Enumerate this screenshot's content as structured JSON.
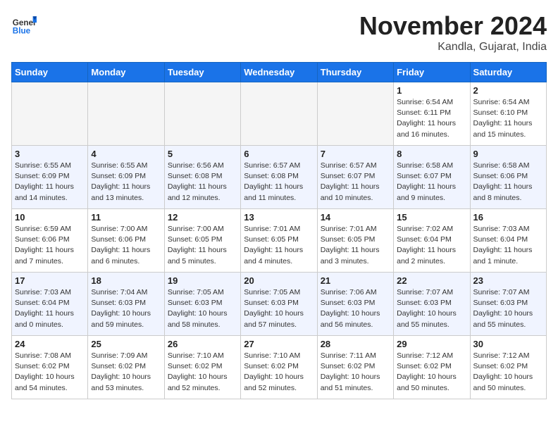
{
  "header": {
    "logo_general": "General",
    "logo_blue": "Blue",
    "month_title": "November 2024",
    "location": "Kandla, Gujarat, India"
  },
  "calendar": {
    "days_of_week": [
      "Sunday",
      "Monday",
      "Tuesday",
      "Wednesday",
      "Thursday",
      "Friday",
      "Saturday"
    ],
    "weeks": [
      [
        {
          "day": "",
          "info": ""
        },
        {
          "day": "",
          "info": ""
        },
        {
          "day": "",
          "info": ""
        },
        {
          "day": "",
          "info": ""
        },
        {
          "day": "",
          "info": ""
        },
        {
          "day": "1",
          "info": "Sunrise: 6:54 AM\nSunset: 6:11 PM\nDaylight: 11 hours\nand 16 minutes."
        },
        {
          "day": "2",
          "info": "Sunrise: 6:54 AM\nSunset: 6:10 PM\nDaylight: 11 hours\nand 15 minutes."
        }
      ],
      [
        {
          "day": "3",
          "info": "Sunrise: 6:55 AM\nSunset: 6:09 PM\nDaylight: 11 hours\nand 14 minutes."
        },
        {
          "day": "4",
          "info": "Sunrise: 6:55 AM\nSunset: 6:09 PM\nDaylight: 11 hours\nand 13 minutes."
        },
        {
          "day": "5",
          "info": "Sunrise: 6:56 AM\nSunset: 6:08 PM\nDaylight: 11 hours\nand 12 minutes."
        },
        {
          "day": "6",
          "info": "Sunrise: 6:57 AM\nSunset: 6:08 PM\nDaylight: 11 hours\nand 11 minutes."
        },
        {
          "day": "7",
          "info": "Sunrise: 6:57 AM\nSunset: 6:07 PM\nDaylight: 11 hours\nand 10 minutes."
        },
        {
          "day": "8",
          "info": "Sunrise: 6:58 AM\nSunset: 6:07 PM\nDaylight: 11 hours\nand 9 minutes."
        },
        {
          "day": "9",
          "info": "Sunrise: 6:58 AM\nSunset: 6:06 PM\nDaylight: 11 hours\nand 8 minutes."
        }
      ],
      [
        {
          "day": "10",
          "info": "Sunrise: 6:59 AM\nSunset: 6:06 PM\nDaylight: 11 hours\nand 7 minutes."
        },
        {
          "day": "11",
          "info": "Sunrise: 7:00 AM\nSunset: 6:06 PM\nDaylight: 11 hours\nand 6 minutes."
        },
        {
          "day": "12",
          "info": "Sunrise: 7:00 AM\nSunset: 6:05 PM\nDaylight: 11 hours\nand 5 minutes."
        },
        {
          "day": "13",
          "info": "Sunrise: 7:01 AM\nSunset: 6:05 PM\nDaylight: 11 hours\nand 4 minutes."
        },
        {
          "day": "14",
          "info": "Sunrise: 7:01 AM\nSunset: 6:05 PM\nDaylight: 11 hours\nand 3 minutes."
        },
        {
          "day": "15",
          "info": "Sunrise: 7:02 AM\nSunset: 6:04 PM\nDaylight: 11 hours\nand 2 minutes."
        },
        {
          "day": "16",
          "info": "Sunrise: 7:03 AM\nSunset: 6:04 PM\nDaylight: 11 hours\nand 1 minute."
        }
      ],
      [
        {
          "day": "17",
          "info": "Sunrise: 7:03 AM\nSunset: 6:04 PM\nDaylight: 11 hours\nand 0 minutes."
        },
        {
          "day": "18",
          "info": "Sunrise: 7:04 AM\nSunset: 6:03 PM\nDaylight: 10 hours\nand 59 minutes."
        },
        {
          "day": "19",
          "info": "Sunrise: 7:05 AM\nSunset: 6:03 PM\nDaylight: 10 hours\nand 58 minutes."
        },
        {
          "day": "20",
          "info": "Sunrise: 7:05 AM\nSunset: 6:03 PM\nDaylight: 10 hours\nand 57 minutes."
        },
        {
          "day": "21",
          "info": "Sunrise: 7:06 AM\nSunset: 6:03 PM\nDaylight: 10 hours\nand 56 minutes."
        },
        {
          "day": "22",
          "info": "Sunrise: 7:07 AM\nSunset: 6:03 PM\nDaylight: 10 hours\nand 55 minutes."
        },
        {
          "day": "23",
          "info": "Sunrise: 7:07 AM\nSunset: 6:03 PM\nDaylight: 10 hours\nand 55 minutes."
        }
      ],
      [
        {
          "day": "24",
          "info": "Sunrise: 7:08 AM\nSunset: 6:02 PM\nDaylight: 10 hours\nand 54 minutes."
        },
        {
          "day": "25",
          "info": "Sunrise: 7:09 AM\nSunset: 6:02 PM\nDaylight: 10 hours\nand 53 minutes."
        },
        {
          "day": "26",
          "info": "Sunrise: 7:10 AM\nSunset: 6:02 PM\nDaylight: 10 hours\nand 52 minutes."
        },
        {
          "day": "27",
          "info": "Sunrise: 7:10 AM\nSunset: 6:02 PM\nDaylight: 10 hours\nand 52 minutes."
        },
        {
          "day": "28",
          "info": "Sunrise: 7:11 AM\nSunset: 6:02 PM\nDaylight: 10 hours\nand 51 minutes."
        },
        {
          "day": "29",
          "info": "Sunrise: 7:12 AM\nSunset: 6:02 PM\nDaylight: 10 hours\nand 50 minutes."
        },
        {
          "day": "30",
          "info": "Sunrise: 7:12 AM\nSunset: 6:02 PM\nDaylight: 10 hours\nand 50 minutes."
        }
      ]
    ]
  }
}
